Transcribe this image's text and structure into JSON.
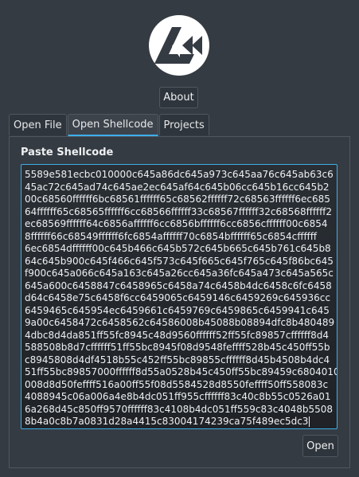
{
  "header": {
    "about_label": "About"
  },
  "tabs": [
    {
      "label": "Open File",
      "active": false
    },
    {
      "label": "Open Shellcode",
      "active": true
    },
    {
      "label": "Projects",
      "active": false
    }
  ],
  "shellcode_panel": {
    "title": "Paste Shellcode",
    "lines": [
      "5589e581ecbc010000c645a86dc645a973c645aa76c645ab63c6",
      "45ac72c645ad74c645ae2ec645af64c645b06cc645b16cc645b2",
      "00c68560ffffff6bc68561ffffff65c68562ffffff72c68563ffffff6ec685",
      "64ffffff65c68565ffffff6cc68566ffffff33c68567ffffff32c68568ffffff2",
      "ec68569ffffff64c6856affffff6cc6856bffffff6cc6856cffffff00c6854",
      "8ffffff66c68549ffffff6fc6854affffff70c6854bffffff65c6854cffffff",
      "6ec6854dffffff00c645b466c645b572c645b665c645b761c645b8",
      "64c645b900c645f466c645f573c645f665c645f765c645f86bc645",
      "f900c645a066c645a163c645a26cc645a36fc645a473c645a565c",
      "645a600c6458847c6458965c6458a74c6458b4dc6458c6fc6458",
      "d64c6458e75c6458f6cc6459065c6459146c6459269c645936cc",
      "6459465c645954ec6459661c6459769c6459865c6459941c645",
      "9a00c6458472c6458562c64586008b45088b08894dfc8b480489",
      "4dbc8d4da851ff55fc8945c48d9560ffffff52ff55fc89857cffffff8d4",
      "588508b8d7cffffff51ff55bc8945f08d9548feffff528b45c450ff55b",
      "c8945808d4df4518b55c452ff55bc89855cffffff8d45b4508b4dc4",
      "51ff55bc89857000ffffff8d55a0528b45c450ff55bc89459c68040100",
      "008d8d50feffff516a00ff55f08d5584528d8550feffff50ff558083c",
      "4088945c06a006a4e8b4dc051ff955cffffff83c40c8b55c0526a01",
      "6a268d45c850ff9570ffffff83c4108b4dc051ff559c83c4048b5508",
      "8b4a0c8b7a0831d28a4415c83004174239ca75f489ec5dc3"
    ]
  },
  "footer": {
    "open_label": "Open"
  }
}
